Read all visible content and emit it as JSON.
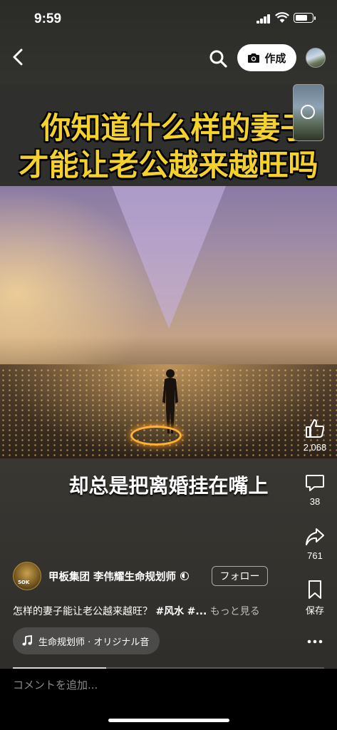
{
  "status_bar": {
    "time": "9:59"
  },
  "header": {
    "create_label": "作成"
  },
  "video": {
    "caption_line1": "你知道什么样的妻子",
    "caption_line2": "才能让老公越来越旺吗",
    "caption_bottom": "却总是把离婚挂在嘴上"
  },
  "actions": {
    "likes": "2,068",
    "comments": "38",
    "shares": "761",
    "save_label": "保存"
  },
  "author": {
    "name": "甲板集团 李伟耀生命规划师",
    "avatar_text": "5OK",
    "follow_label": "フォロー"
  },
  "description": {
    "text": "怎样的妻子能让老公越来越旺？",
    "tag1": "#风水",
    "tag2": "#...",
    "more": "もっと見る"
  },
  "music": {
    "label": "生命规划师 · オリジナル音"
  },
  "playback": {
    "progress_fraction": 0.3
  },
  "comment": {
    "placeholder": "コメントを追加..."
  }
}
